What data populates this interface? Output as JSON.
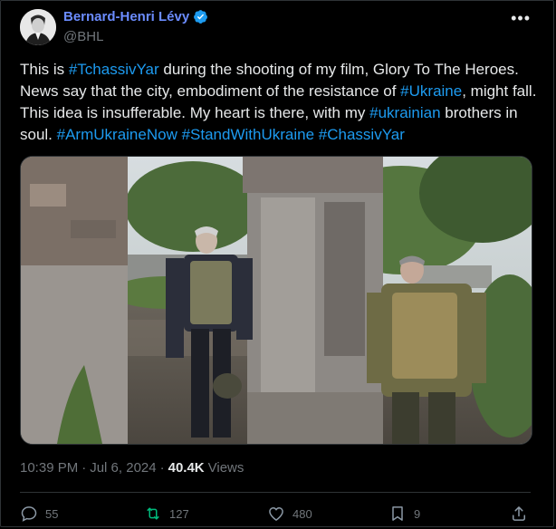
{
  "author": {
    "display_name": "Bernard-Henri Lévy",
    "handle": "@BHL",
    "verified_color": "#1d9bf0"
  },
  "tweet": {
    "segments": [
      {
        "text": "This is ",
        "type": "text"
      },
      {
        "text": "#TchassivYar",
        "type": "hashtag"
      },
      {
        "text": " during the shooting of my film, Glory To The Heroes. News say that the city, embodiment of the resistance of ",
        "type": "text"
      },
      {
        "text": "#Ukraine",
        "type": "hashtag"
      },
      {
        "text": ", might fall. This idea is insufferable. My heart is there, with my ",
        "type": "text"
      },
      {
        "text": "#ukrainian",
        "type": "hashtag"
      },
      {
        "text": " brothers in soul. ",
        "type": "text"
      },
      {
        "text": "#ArmUkraineNow",
        "type": "hashtag"
      },
      {
        "text": " ",
        "type": "text"
      },
      {
        "text": "#StandWithUkraine",
        "type": "hashtag"
      },
      {
        "text": " ",
        "type": "text"
      },
      {
        "text": "#ChassivYar",
        "type": "hashtag"
      }
    ]
  },
  "meta": {
    "time": "10:39 PM",
    "separator": "·",
    "date": "Jul 6, 2024",
    "views_count": "40.4K",
    "views_label": "Views"
  },
  "actions": {
    "replies": "55",
    "reposts": "127",
    "likes": "480",
    "bookmarks": "9"
  },
  "colors": {
    "accent": "#1d9bf0",
    "name": "#6b8cff",
    "muted": "#71767b",
    "repost_hover": "#00ba7c"
  },
  "icons": [
    "more-icon",
    "verified-badge-icon",
    "reply-icon",
    "repost-icon",
    "like-icon",
    "bookmark-icon",
    "share-icon"
  ]
}
